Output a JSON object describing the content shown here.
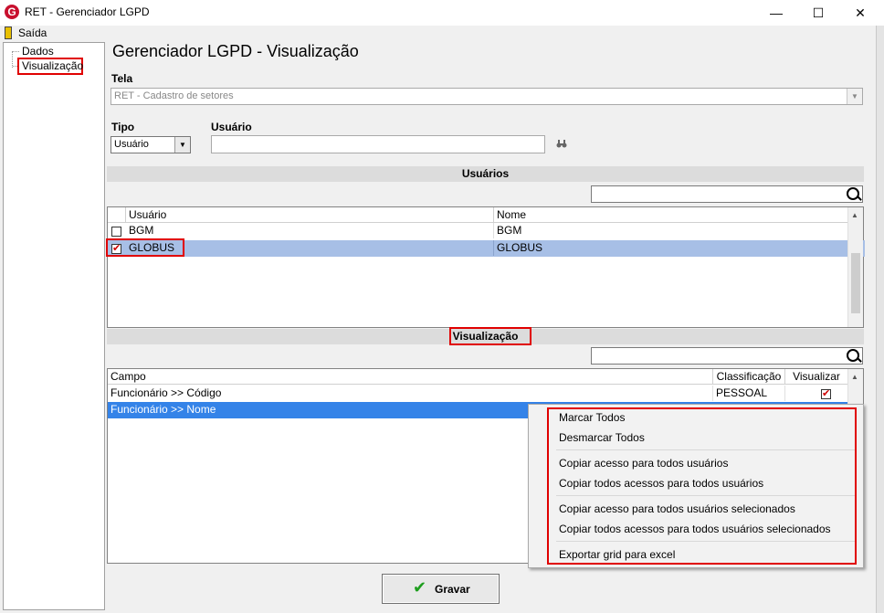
{
  "window": {
    "title": "RET - Gerenciador LGPD",
    "minimize": "—",
    "maximize": "☐",
    "close": "✕",
    "logo": "G"
  },
  "menu": {
    "saida": "Saída"
  },
  "tree": {
    "items": [
      {
        "label": "Dados"
      },
      {
        "label": "Visualização"
      }
    ]
  },
  "page_title": "Gerenciador LGPD - Visualização",
  "tela": {
    "label": "Tela",
    "value": "RET - Cadastro de setores"
  },
  "tipo": {
    "label": "Tipo",
    "value": "Usuário"
  },
  "usuario": {
    "label": "Usuário",
    "value": ""
  },
  "usuarios_section": {
    "title": "Usuários",
    "columns": [
      "Usuário",
      "Nome"
    ],
    "rows": [
      {
        "usuario": "BGM",
        "nome": "BGM",
        "checked": false
      },
      {
        "usuario": "GLOBUS",
        "nome": "GLOBUS",
        "checked": true
      }
    ]
  },
  "visualizacao_section": {
    "title": "Visualização",
    "columns": [
      "Campo",
      "Classificação",
      "Visualizar"
    ],
    "rows": [
      {
        "campo": "Funcionário >> Código",
        "classificacao": "PESSOAL",
        "visualizar": true
      },
      {
        "campo": "Funcionário >> Nome",
        "classificacao": "",
        "visualizar": false
      }
    ]
  },
  "context_menu": {
    "items": [
      "Marcar Todos",
      "Desmarcar Todos",
      "Copiar acesso para todos usuários",
      "Copiar todos acessos para todos usuários",
      "Copiar acesso para todos usuários selecionados",
      "Copiar todos acessos para todos usuários selecionados",
      "Exportar grid para excel"
    ]
  },
  "buttons": {
    "gravar": "Gravar"
  },
  "colors": {
    "selection_blue": "#a7bfe6",
    "highlight_blue": "#3483e8",
    "annotation_red": "#e00000",
    "check_green": "#1e9e1e"
  },
  "icons": {
    "binoculars": "binoculars-icon",
    "search": "search-icon",
    "checkmark": "check-icon",
    "exit": "exit-door-icon"
  }
}
